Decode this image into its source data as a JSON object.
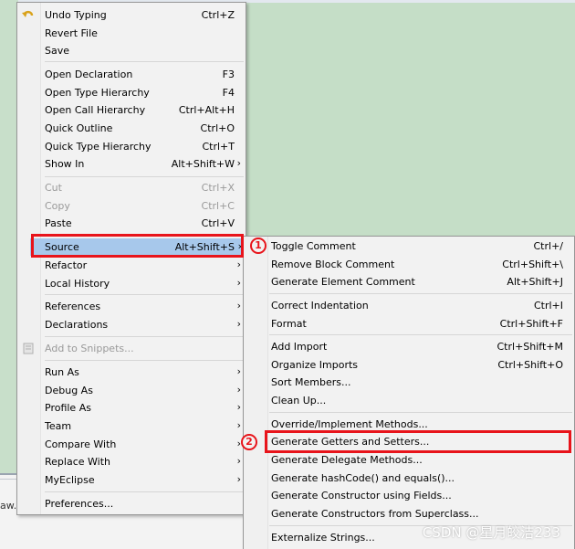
{
  "status_text": "aw.",
  "main_menu": {
    "items": [
      {
        "label": "Undo Typing",
        "acc": "Ctrl+Z"
      },
      {
        "label": "Revert File",
        "acc": ""
      },
      {
        "label": "Save",
        "acc": ""
      },
      {
        "label": "Open Declaration",
        "acc": "F3"
      },
      {
        "label": "Open Type Hierarchy",
        "acc": "F4"
      },
      {
        "label": "Open Call Hierarchy",
        "acc": "Ctrl+Alt+H"
      },
      {
        "label": "Quick Outline",
        "acc": "Ctrl+O"
      },
      {
        "label": "Quick Type Hierarchy",
        "acc": "Ctrl+T"
      },
      {
        "label": "Show In",
        "acc": "Alt+Shift+W"
      },
      {
        "label": "Cut",
        "acc": "Ctrl+X"
      },
      {
        "label": "Copy",
        "acc": "Ctrl+C"
      },
      {
        "label": "Paste",
        "acc": "Ctrl+V"
      },
      {
        "label": "Source",
        "acc": "Alt+Shift+S"
      },
      {
        "label": "Refactor",
        "acc": ""
      },
      {
        "label": "Local History",
        "acc": ""
      },
      {
        "label": "References",
        "acc": ""
      },
      {
        "label": "Declarations",
        "acc": ""
      },
      {
        "label": "Add to Snippets...",
        "acc": ""
      },
      {
        "label": "Run As",
        "acc": ""
      },
      {
        "label": "Debug As",
        "acc": ""
      },
      {
        "label": "Profile As",
        "acc": ""
      },
      {
        "label": "Team",
        "acc": ""
      },
      {
        "label": "Compare With",
        "acc": ""
      },
      {
        "label": "Replace With",
        "acc": ""
      },
      {
        "label": "MyEclipse",
        "acc": ""
      },
      {
        "label": "Preferences...",
        "acc": ""
      }
    ]
  },
  "sub_menu": {
    "items": [
      {
        "label": "Toggle Comment",
        "acc": "Ctrl+/"
      },
      {
        "label": "Remove Block Comment",
        "acc": "Ctrl+Shift+\\"
      },
      {
        "label": "Generate Element Comment",
        "acc": "Alt+Shift+J"
      },
      {
        "label": "Correct Indentation",
        "acc": "Ctrl+I"
      },
      {
        "label": "Format",
        "acc": "Ctrl+Shift+F"
      },
      {
        "label": "Add Import",
        "acc": "Ctrl+Shift+M"
      },
      {
        "label": "Organize Imports",
        "acc": "Ctrl+Shift+O"
      },
      {
        "label": "Sort Members...",
        "acc": ""
      },
      {
        "label": "Clean Up...",
        "acc": ""
      },
      {
        "label": "Override/Implement Methods...",
        "acc": ""
      },
      {
        "label": "Generate Getters and Setters...",
        "acc": ""
      },
      {
        "label": "Generate Delegate Methods...",
        "acc": ""
      },
      {
        "label": "Generate hashCode() and equals()...",
        "acc": ""
      },
      {
        "label": "Generate Constructor using Fields...",
        "acc": ""
      },
      {
        "label": "Generate Constructors from Superclass...",
        "acc": ""
      },
      {
        "label": "Externalize Strings...",
        "acc": ""
      }
    ]
  },
  "submenu_arrow": "›",
  "annotations": {
    "step1": "1",
    "step2": "2"
  },
  "watermark": "CSDN @星月皎洁233",
  "colors": {
    "highlight": "#a7c8eb",
    "annotation_red": "#e8141b",
    "editor_bg": "#c5dec7"
  }
}
